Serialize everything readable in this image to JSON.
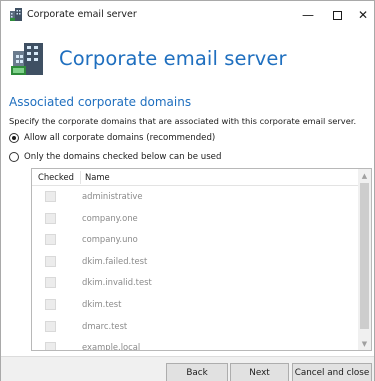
{
  "window": {
    "title": "Corporate email server",
    "controls": {
      "minimize": "—",
      "maximize": "☐",
      "close": "✕"
    }
  },
  "header": {
    "title": "Corporate email server",
    "icon": "server-building-icon"
  },
  "section": {
    "title": "Associated corporate domains",
    "description": "Specify the corporate domains that are associated with this corporate email server."
  },
  "options": [
    {
      "label": "Allow all corporate domains (recommended)",
      "selected": true
    },
    {
      "label": "Only the domains checked below can be used",
      "selected": false
    }
  ],
  "table": {
    "columns": {
      "checked": "Checked",
      "name": "Name"
    },
    "rows": [
      {
        "name": "administrative",
        "checked": false
      },
      {
        "name": "company.one",
        "checked": false
      },
      {
        "name": "company.uno",
        "checked": false
      },
      {
        "name": "dkim.failed.test",
        "checked": false
      },
      {
        "name": "dkim.invalid.test",
        "checked": false
      },
      {
        "name": "dkim.test",
        "checked": false
      },
      {
        "name": "dmarc.test",
        "checked": false
      },
      {
        "name": "example.local",
        "checked": false
      }
    ]
  },
  "footer": {
    "back": "Back",
    "next": "Next",
    "cancel": "Cancel and close"
  },
  "colors": {
    "accent": "#1f6fbf",
    "disabled_text": "#8a8a8a",
    "footer_bg": "#f0f0f0"
  }
}
